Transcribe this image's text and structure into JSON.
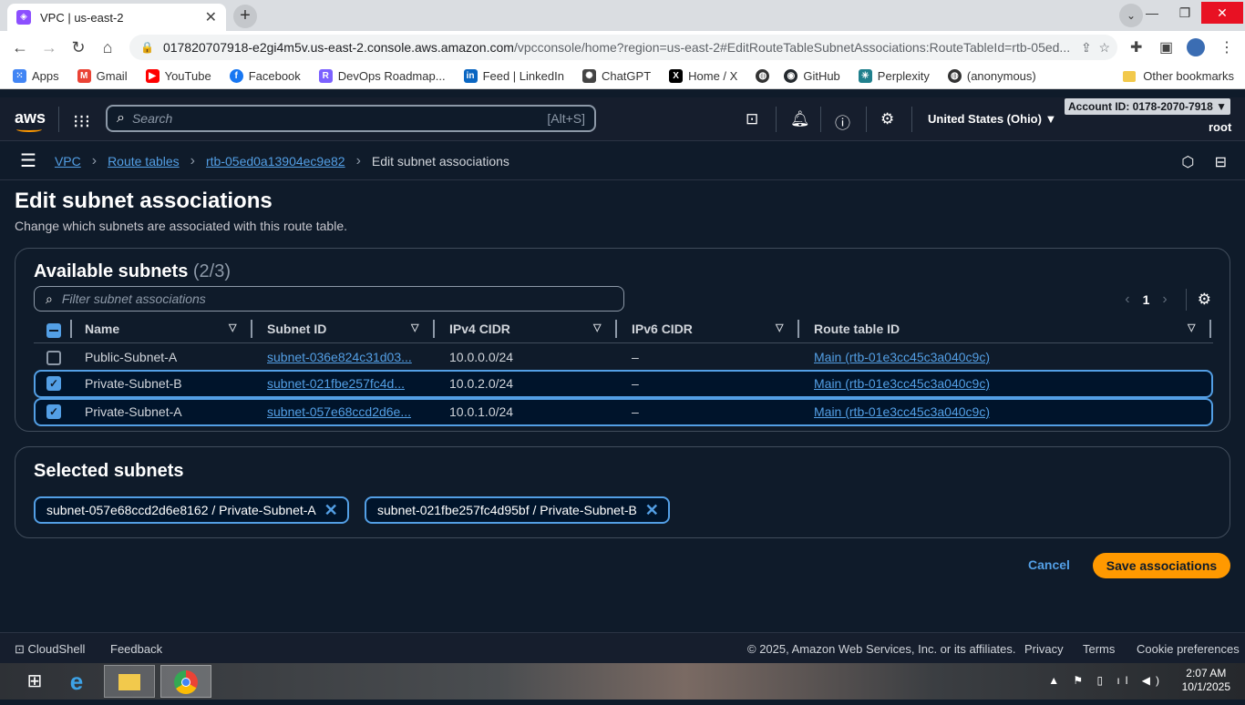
{
  "browser": {
    "tab_title": "VPC | us-east-2",
    "url_domain": "017820707918-e2gi4m5v.us-east-2.console.aws.amazon.com",
    "url_path": "/vpcconsole/home?region=us-east-2#EditRouteTableSubnetAssociations:RouteTableId=rtb-05ed...",
    "bookmarks": [
      {
        "label": "Apps",
        "color": "#4285f4"
      },
      {
        "label": "Gmail",
        "color": "#ea4335"
      },
      {
        "label": "YouTube",
        "color": "#ff0000"
      },
      {
        "label": "Facebook",
        "color": "#1877f2"
      },
      {
        "label": "DevOps Roadmap...",
        "color": "#7b61ff"
      },
      {
        "label": "Feed | LinkedIn",
        "color": "#0a66c2"
      },
      {
        "label": "ChatGPT",
        "color": "#444444"
      },
      {
        "label": "Home / X",
        "color": "#000000"
      },
      {
        "label": "",
        "color": "#333333"
      },
      {
        "label": "GitHub",
        "color": "#24292e"
      },
      {
        "label": "Perplexity",
        "color": "#20808d"
      },
      {
        "label": "(anonymous)",
        "color": "#333333"
      }
    ],
    "other_bookmarks": "Other bookmarks"
  },
  "aws_nav": {
    "logo": "aws",
    "search_placeholder": "Search",
    "search_shortcut": "[Alt+S]",
    "region": "United States (Ohio) ▼",
    "account": "Account ID: 0178-2070-7918 ▼",
    "user": "root"
  },
  "breadcrumb": {
    "items": [
      "VPC",
      "Route tables",
      "rtb-05ed0a13904ec9e82"
    ],
    "current": "Edit subnet associations"
  },
  "page": {
    "title": "Edit subnet associations",
    "description": "Change which subnets are associated with this route table."
  },
  "available": {
    "title": "Available subnets",
    "count": "(2/3)",
    "filter_placeholder": "Filter subnet associations",
    "page": "1",
    "columns": [
      "Name",
      "Subnet ID",
      "IPv4 CIDR",
      "IPv6 CIDR",
      "Route table ID"
    ],
    "rows": [
      {
        "checked": false,
        "name": "Public-Subnet-A",
        "subnet_id": "subnet-036e824c31d03...",
        "ipv4": "10.0.0.0/24",
        "ipv6": "–",
        "route_table": "Main (rtb-01e3cc45c3a040c9c)"
      },
      {
        "checked": true,
        "name": "Private-Subnet-B",
        "subnet_id": "subnet-021fbe257fc4d...",
        "ipv4": "10.0.2.0/24",
        "ipv6": "–",
        "route_table": "Main (rtb-01e3cc45c3a040c9c)"
      },
      {
        "checked": true,
        "name": "Private-Subnet-A",
        "subnet_id": "subnet-057e68ccd2d6e...",
        "ipv4": "10.0.1.0/24",
        "ipv6": "–",
        "route_table": "Main (rtb-01e3cc45c3a040c9c)"
      }
    ]
  },
  "selected": {
    "title": "Selected subnets",
    "tokens": [
      "subnet-057e68ccd2d6e8162 / Private-Subnet-A",
      "subnet-021fbe257fc4d95bf / Private-Subnet-B"
    ]
  },
  "actions": {
    "cancel": "Cancel",
    "save": "Save associations"
  },
  "footer": {
    "cloudshell": "CloudShell",
    "feedback": "Feedback",
    "copyright": "© 2025, Amazon Web Services, Inc. or its affiliates.",
    "privacy": "Privacy",
    "terms": "Terms",
    "cookies": "Cookie preferences"
  },
  "taskbar": {
    "time": "2:07 AM",
    "date": "10/1/2025"
  }
}
